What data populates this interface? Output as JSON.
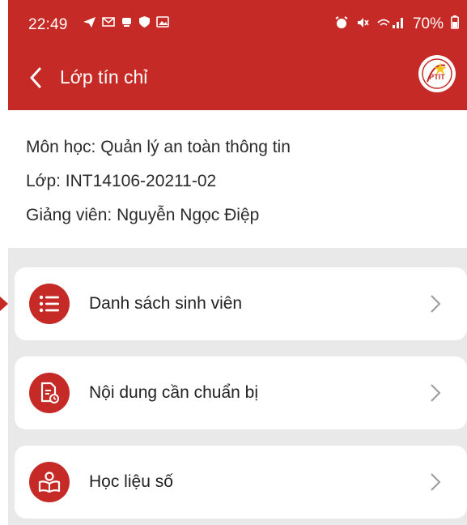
{
  "status_bar": {
    "time": "22:49",
    "icons_left": [
      "send-icon",
      "mail-icon",
      "notification-icon",
      "shield-icon",
      "image-icon"
    ],
    "icons_right": [
      "alarm-icon",
      "mute-icon",
      "signal-icon"
    ],
    "battery": "70%"
  },
  "app_bar": {
    "back_icon": "chevron-left-icon",
    "title": "Lớp tín chỉ",
    "logo": "ptit-logo",
    "logo_text": "PTIT"
  },
  "course_info": {
    "subject": "Môn học: Quản lý an toàn thông tin",
    "class": "Lớp: INT14106-20211-02",
    "lecturer": "Giảng viên: Nguyễn Ngọc Điệp"
  },
  "menu": [
    {
      "label": "Danh sách sinh viên",
      "icon": "list-icon"
    },
    {
      "label": "Nội dung cần chuẩn bị",
      "icon": "document-icon"
    },
    {
      "label": "Học liệu số",
      "icon": "book-reader-icon"
    }
  ],
  "colors": {
    "primary": "#c62a26",
    "background": "#e9e9e9",
    "card": "#ffffff",
    "text": "#222222"
  }
}
